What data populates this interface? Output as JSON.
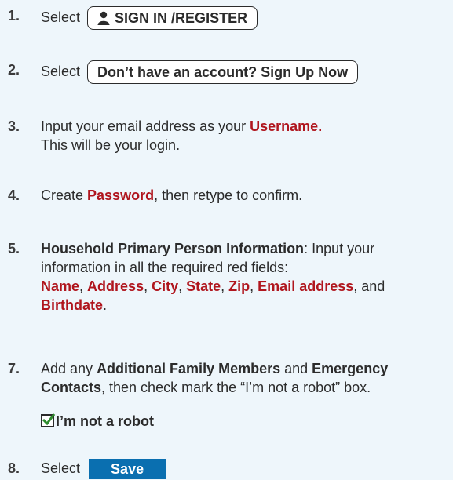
{
  "steps": [
    {
      "num": "1.",
      "prefix": "Select",
      "button_label": "SIGN IN /REGISTER"
    },
    {
      "num": "2.",
      "prefix": "Select",
      "button_label": "Don’t have an account? Sign Up Now"
    },
    {
      "num": "3.",
      "text_a": "Input your email address as your ",
      "red": "Username.",
      "line2": "This will be your login."
    },
    {
      "num": "4.",
      "text_a": "Create ",
      "red": "Password",
      "text_b": ", then retype to confirm."
    },
    {
      "num": "5.",
      "bold": "Household Primary Person Information",
      "text_a": ": Input your information in all the required red fields:",
      "fields": [
        "Name",
        "Address",
        "City",
        "State",
        "Zip",
        "Email address",
        "Birthdate"
      ],
      "sep": ", ",
      "and": ", and ",
      "end": "."
    },
    {
      "num": "7.",
      "text_a": "Add any ",
      "bold_a": "Additional Family Members",
      "text_b": " and ",
      "bold_b": "Emergency Contacts",
      "text_c": ", then check mark the “I’m not a robot” box.",
      "robot_label": "I’m not a robot"
    },
    {
      "num": "8.",
      "prefix": "Select",
      "button_label": "Save"
    }
  ],
  "colors": {
    "red": "#b0161e",
    "save_blue": "#0a6fb0",
    "background": "#eef6fb"
  },
  "icons": {
    "person": "person-icon",
    "check": "checkmark-icon"
  }
}
